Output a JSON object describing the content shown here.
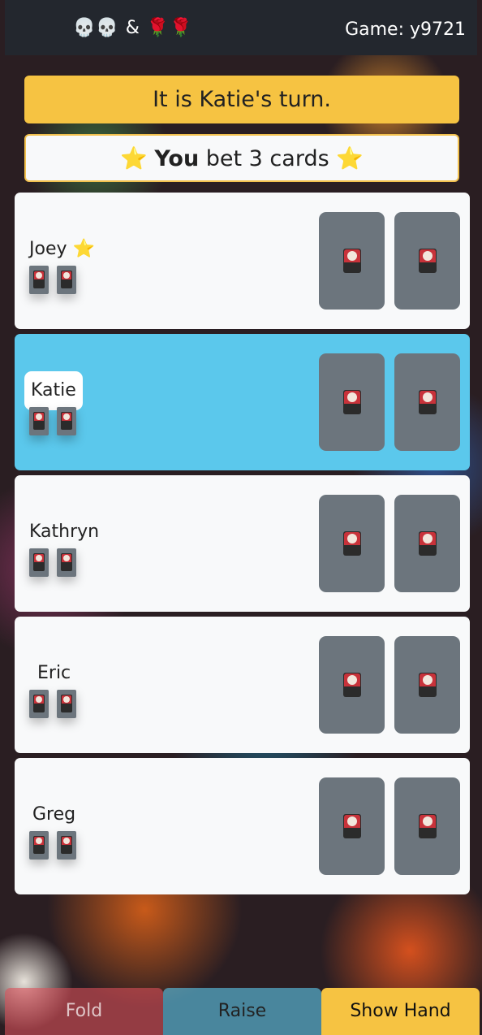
{
  "header": {
    "title": "💀💀 & 🌹🌹",
    "game_label": "Game: y9721"
  },
  "status": {
    "turn_text": "It is Katie's turn.",
    "bet_prefix": "⭐ ",
    "bet_you": "You",
    "bet_text": " bet 3 cards ⭐"
  },
  "players": [
    {
      "name": "Joey ⭐",
      "active": false
    },
    {
      "name": "Katie",
      "active": true
    },
    {
      "name": "Kathryn",
      "active": false
    },
    {
      "name": "Eric",
      "active": false
    },
    {
      "name": "Greg",
      "active": false
    }
  ],
  "actions": {
    "fold": "Fold",
    "raise": "Raise",
    "show_hand": "Show Hand"
  },
  "colors": {
    "topbar": "#23272e",
    "turn_banner": "#f6c342",
    "active_player": "#5bc8ec",
    "card_back": "#6c757d"
  }
}
